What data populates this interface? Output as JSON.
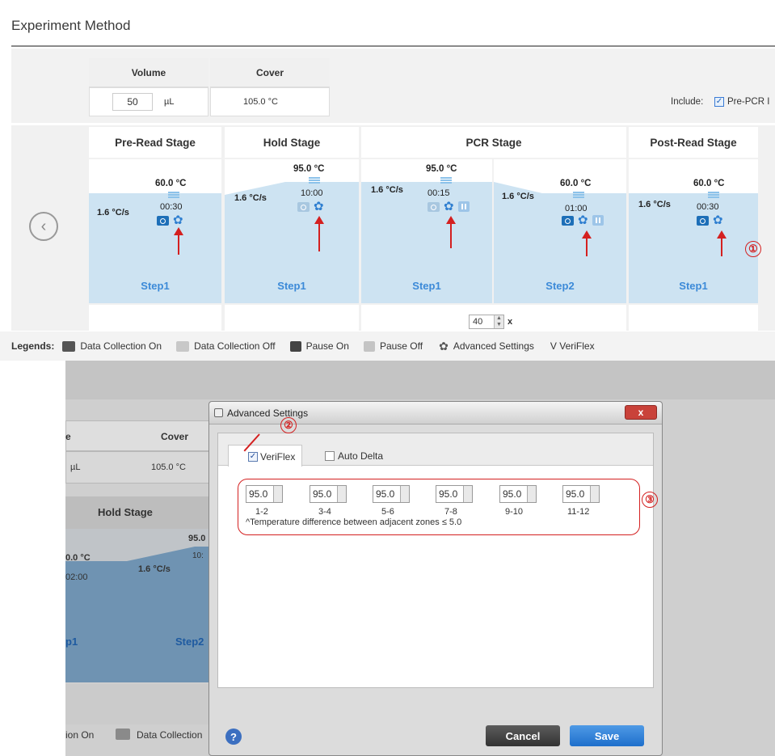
{
  "page_title": "Experiment Method",
  "top": {
    "volume_label": "Volume",
    "cover_label": "Cover",
    "volume_value": "50",
    "volume_unit": "µL",
    "cover_value": "105.0 °C",
    "include_label": "Include:",
    "include_option": "Pre-PCR I"
  },
  "stages": [
    {
      "name": "Pre-Read Stage"
    },
    {
      "name": "Hold Stage"
    },
    {
      "name": "PCR Stage"
    },
    {
      "name": "Post-Read Stage"
    }
  ],
  "steps": [
    {
      "temp": "60.0 °C",
      "rate": "1.6 °C/s",
      "time": "00:30",
      "label": "Step1"
    },
    {
      "temp": "95.0 °C",
      "rate": "1.6 °C/s",
      "time": "10:00",
      "label": "Step1"
    },
    {
      "temp": "95.0 °C",
      "rate": "1.6 °C/s",
      "time": "00:15",
      "label": "Step1"
    },
    {
      "temp": "60.0 °C",
      "rate": "1.6 °C/s",
      "time": "01:00",
      "label": "Step2"
    },
    {
      "temp": "60.0 °C",
      "rate": "1.6 °C/s",
      "time": "00:30",
      "label": "Step1"
    }
  ],
  "cycles": {
    "value": "40",
    "suffix": "x"
  },
  "legend": {
    "title": "Legends:",
    "items": [
      "Data Collection On",
      "Data Collection Off",
      "Pause On",
      "Pause Off",
      "Advanced Settings",
      "V VeriFlex"
    ]
  },
  "callouts": [
    "①",
    "②",
    "③"
  ],
  "bg_screen": {
    "cover_label": "Cover",
    "unit_fragment": "µL",
    "header_fragment": "e",
    "cover_value": "105.0 °C",
    "hold_stage": "Hold Stage",
    "temp_fragment": "0.0 °C",
    "time_fragment": "02:00",
    "rate": "1.6 °C/s",
    "temp_fragment2": "95.0",
    "time_fragment2": "10:",
    "step_fragment": "p1",
    "step2": "Step2",
    "legend_on_fragment": "ion On",
    "legend_off_fragment": "Data Collection"
  },
  "dialog": {
    "title": "Advanced Settings",
    "tab_veriflex": "VeriFlex",
    "tab_auto_delta": "Auto Delta",
    "zones": [
      {
        "value": "95.0",
        "label": "1-2"
      },
      {
        "value": "95.0",
        "label": "3-4"
      },
      {
        "value": "95.0",
        "label": "5-6"
      },
      {
        "value": "95.0",
        "label": "7-8"
      },
      {
        "value": "95.0",
        "label": "9-10"
      },
      {
        "value": "95.0",
        "label": "11-12"
      }
    ],
    "note": "^Temperature difference between adjacent zones ≤ 5.0",
    "cancel": "Cancel",
    "save": "Save",
    "help": "?",
    "close": "x"
  }
}
